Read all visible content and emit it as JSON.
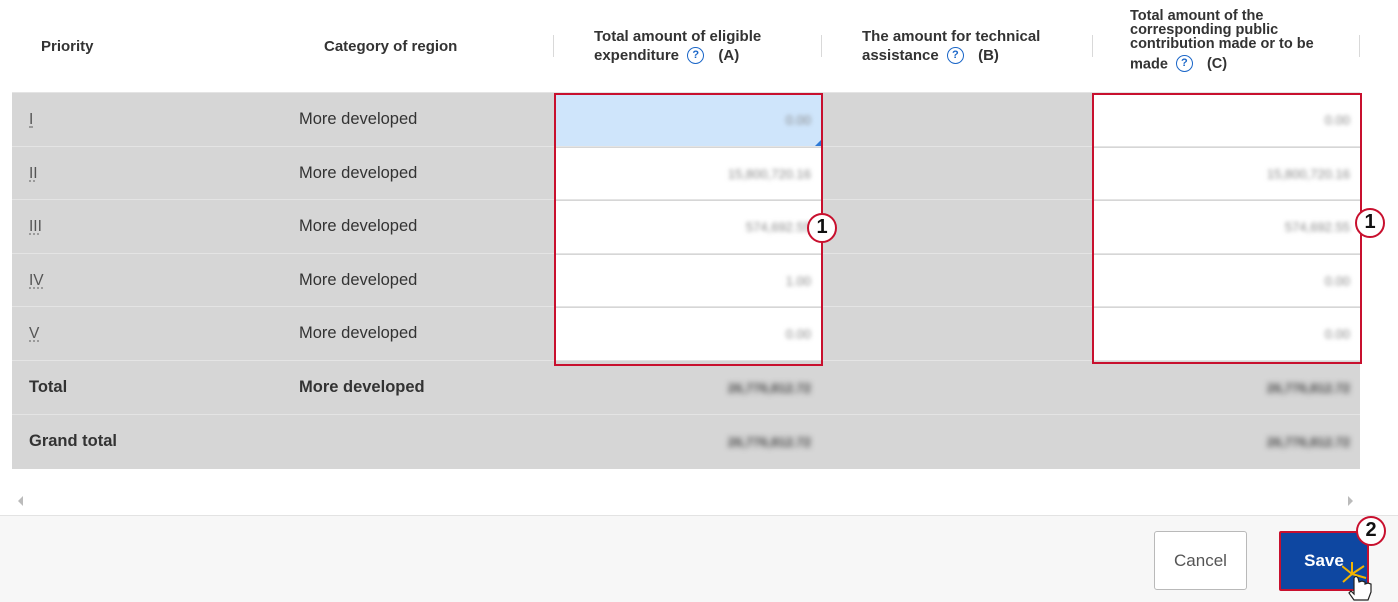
{
  "table": {
    "headers": {
      "priority": "Priority",
      "category": "Category of region",
      "eligible_line1": "Total amount of eligible",
      "eligible_line2": "expenditure",
      "eligible_suffix": "(A)",
      "technical_line1": "The amount for technical",
      "technical_line2": "assistance",
      "technical_suffix": "(B)",
      "public_line1": "Total amount of the",
      "public_line2": "corresponding public",
      "public_line3": "contribution made or to be",
      "public_line4": "made",
      "public_suffix": "(C)",
      "help_glyph": "?"
    },
    "rows": [
      {
        "priority": "I",
        "category": "More developed",
        "a": "0.00",
        "c": "0.00"
      },
      {
        "priority": "II",
        "category": "More developed",
        "a": "15,800,720.16",
        "c": "15,800,720.16"
      },
      {
        "priority": "III",
        "category": "More developed",
        "a": "574,692.55",
        "c": "574,692.55"
      },
      {
        "priority": "IV",
        "category": "More developed",
        "a": "1.00",
        "c": "0.00"
      },
      {
        "priority": "V",
        "category": "More developed",
        "a": "0.00",
        "c": "0.00"
      }
    ],
    "total": {
      "label": "Total",
      "category": "More developed",
      "a": "26,776,812.72",
      "c": "26,776,812.72"
    },
    "grand_total": {
      "label": "Grand total",
      "a": "26,776,812.72",
      "c": "26,776,812.72"
    }
  },
  "callouts": {
    "one": "1",
    "two": "2"
  },
  "footer": {
    "cancel_label": "Cancel",
    "save_label": "Save"
  },
  "colors": {
    "highlight": "#c8102e",
    "save_button": "#0e47a1",
    "row_bg": "#d6d6d6",
    "help_icon": "#1a66c8"
  }
}
